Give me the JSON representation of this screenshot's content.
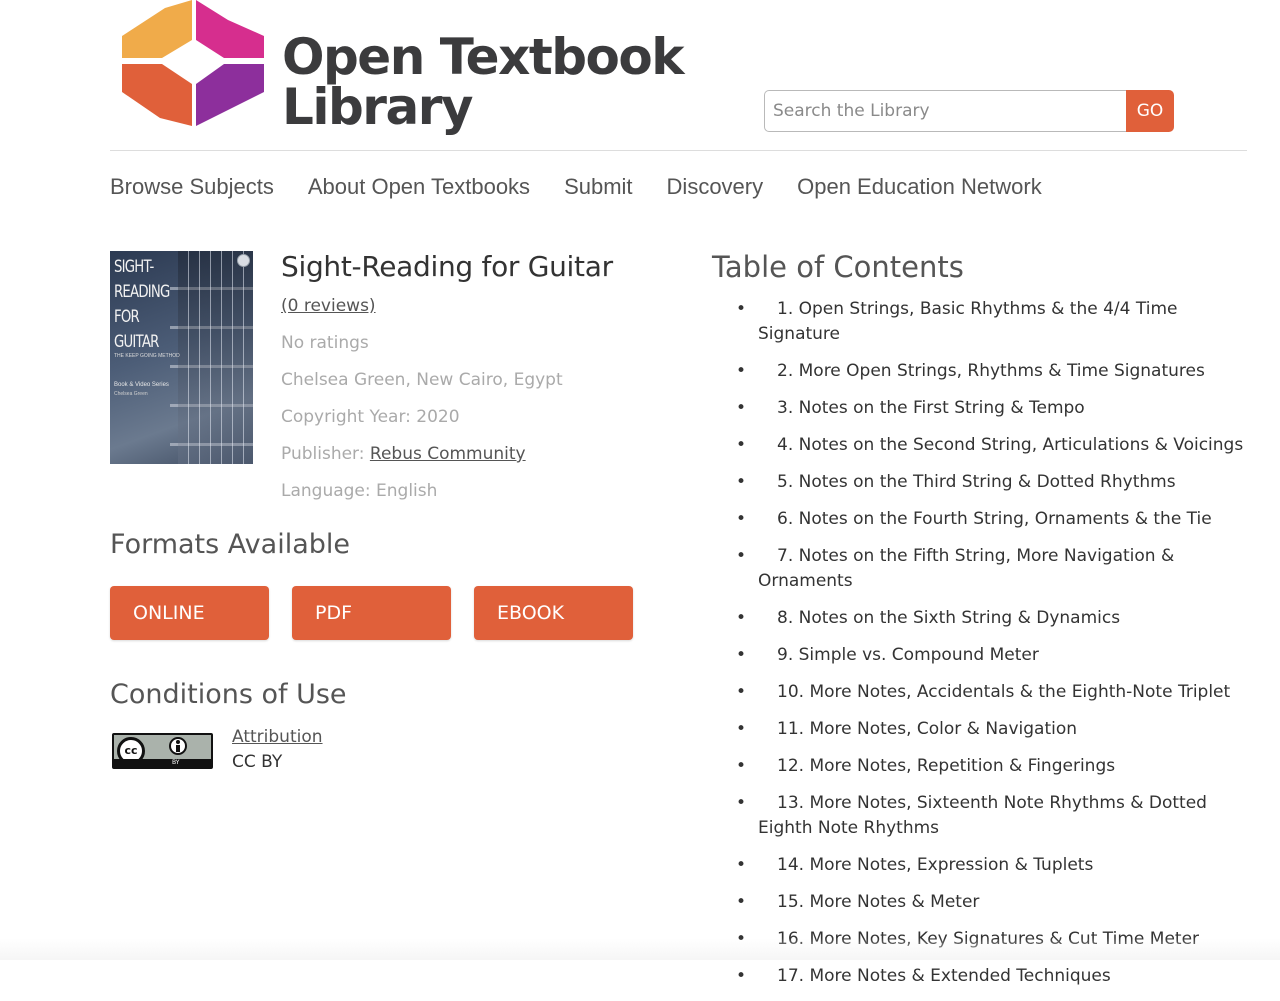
{
  "logo": {
    "line1": "Open Textbook",
    "line2": "Library",
    "colors": [
      "#f0ab4a",
      "#d62e8e",
      "#e0603a",
      "#8d2f9c"
    ]
  },
  "search": {
    "placeholder": "Search the Library",
    "value": "",
    "go_label": "GO"
  },
  "nav": {
    "items": [
      "Browse Subjects",
      "About Open Textbooks",
      "Submit",
      "Discovery",
      "Open Education Network"
    ]
  },
  "book": {
    "title": "Sight-Reading for Guitar",
    "reviews": "(0 reviews)",
    "rating": "No ratings",
    "authors": "Chelsea Green, New Cairo, Egypt",
    "copyright": "Copyright Year: 2020",
    "publisher_label": "Publisher: ",
    "publisher": "Rebus Community",
    "language": "Language: English",
    "cover": {
      "title_lines": [
        "SIGHT-",
        "READING",
        "FOR",
        "GUITAR"
      ],
      "subtitle": "THE KEEP GOING METHOD",
      "series": "Book & Video Series",
      "author": "Chelsea Green"
    }
  },
  "formats": {
    "heading": "Formats Available",
    "buttons": [
      "ONLINE",
      "PDF",
      "EBOOK"
    ]
  },
  "conditions": {
    "heading": "Conditions of Use",
    "badge_cc": "cc",
    "badge_by": "BY",
    "license_link": "Attribution",
    "license_name": "CC BY"
  },
  "toc": {
    "heading": "Table of Contents",
    "items": [
      "1. Open Strings, Basic Rhythms & the 4/4 Time Signature",
      "2. More Open Strings, Rhythms & Time Signatures",
      "3. Notes on the First String & Tempo",
      "4. Notes on the Second String, Articulations & Voicings",
      "5. Notes on the Third String & Dotted Rhythms",
      "6. Notes on the Fourth String, Ornaments & the Tie",
      "7. Notes on the Fifth String, More Navigation & Ornaments",
      "8. Notes on the Sixth String & Dynamics",
      "9. Simple vs. Compound Meter",
      "10. More Notes, Accidentals & the Eighth-Note Triplet",
      "11. More Notes, Color & Navigation",
      "12. More Notes, Repetition & Fingerings",
      "13. More Notes, Sixteenth Note Rhythms & Dotted Eighth Note Rhythms",
      "14. More Notes, Expression & Tuplets",
      "15. More Notes & Meter",
      "16. More Notes, Key Signatures & Cut Time Meter",
      "17. More Notes & Extended Techniques"
    ]
  },
  "colors": {
    "accent": "#e0603a",
    "text": "#333333",
    "muted": "#aaaaaa",
    "nav": "#555555"
  }
}
